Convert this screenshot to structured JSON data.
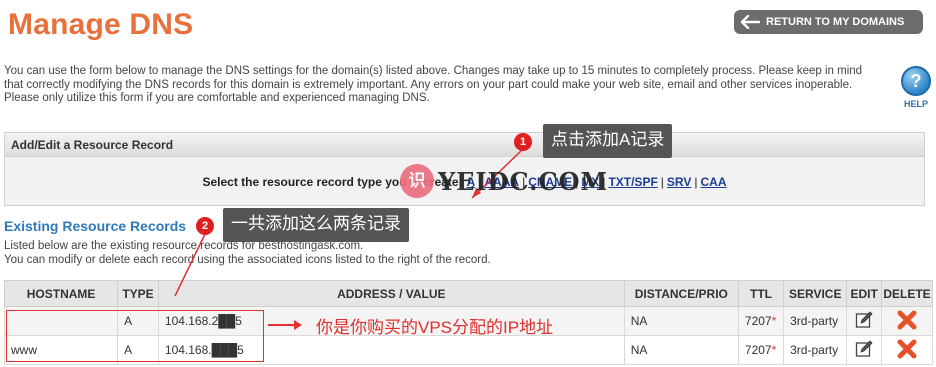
{
  "page_title": "Manage DNS",
  "return_button": "RETURN TO MY DOMAINS",
  "intro_text": "You can use the form below to manage the DNS settings for the domain(s) listed above. Changes may take up to 15 minutes to completely process. Please keep in mind that correctly modifying the DNS records for this domain is extremely important. Any errors on your part could make your web site, email and other services inoperable. Please only utilize this form if you are comfortable and experienced managing DNS.",
  "help": {
    "icon_glyph": "?",
    "label": "HELP"
  },
  "add_edit_panel": {
    "title": "Add/Edit a Resource Record",
    "prompt": "Select the resource record type you w",
    "prompt_tail": "create:",
    "types": [
      "A",
      "AAAA",
      "CNAME",
      "MX",
      "TXT/SPF",
      "SRV",
      "CAA"
    ]
  },
  "existing": {
    "title": "Existing Resource Records",
    "desc_line1": "Listed below are the existing resource records for besthostingask.com.",
    "desc_line2": "You can modify or delete each record using the associated icons listed to the right of the record."
  },
  "table": {
    "headers": [
      "HOSTNAME",
      "TYPE",
      "ADDRESS / VALUE",
      "DISTANCE/PRIO",
      "TTL",
      "SERVICE",
      "EDIT",
      "DELETE"
    ],
    "rows": [
      {
        "hostname": "",
        "type": "A",
        "address": "104.168.2██5",
        "distance": "NA",
        "ttl": "7207",
        "ttl_mark": "*",
        "service": "3rd-party"
      },
      {
        "hostname": "www",
        "type": "A",
        "address": "104.168.███5",
        "distance": "NA",
        "ttl": "7207",
        "ttl_mark": "*",
        "service": "3rd-party"
      }
    ]
  },
  "annotations": {
    "badge1": "1",
    "callout1": "点击添加A记录",
    "badge2": "2",
    "callout2": "一共添加这么两条记录",
    "arrow_text": "你是你购买的VPS分配的IP地址"
  },
  "watermark": {
    "glyph": "识",
    "text": "YEIDC.COM"
  },
  "colors": {
    "title": "#e8703a",
    "link": "#1a3d8f",
    "section_title": "#2f7ab8",
    "annotation": "#e03030",
    "delete": "#e8502a"
  }
}
